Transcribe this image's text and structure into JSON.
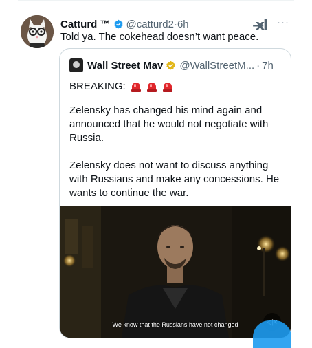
{
  "tweet": {
    "author_name": "Catturd ™",
    "handle": "@catturd2",
    "separator": "·",
    "time": "6h",
    "more_label": "···",
    "x_logo_label": "x̶I",
    "text": "Told ya. The cokehead doesn’t want peace."
  },
  "quote": {
    "author_name": "Wall Street Mav",
    "handle": "@WallStreetM...",
    "separator": "·",
    "time": "7h",
    "breaking": "BREAKING:",
    "paragraph1": "Zelensky has changed his mind again and announced that he would not negotiate with Russia.",
    "paragraph2": "Zelensky does not want to discuss anything with Russians and make any concessions. He wants to continue the war.",
    "video_caption": "We know that the Russians have not changed",
    "mute_label": "◁×"
  },
  "colors": {
    "verified_blue": "#1d9bf0",
    "verified_gold": "#e2b719",
    "muted_text": "#536471",
    "siren_red": "#e0262b"
  },
  "icons": {
    "verified": "verified-badge-icon",
    "gold_verified": "gold-verified-badge-icon",
    "siren": "police-siren-icon",
    "mute": "speaker-muted-icon",
    "more": "more-horizontal-icon"
  }
}
